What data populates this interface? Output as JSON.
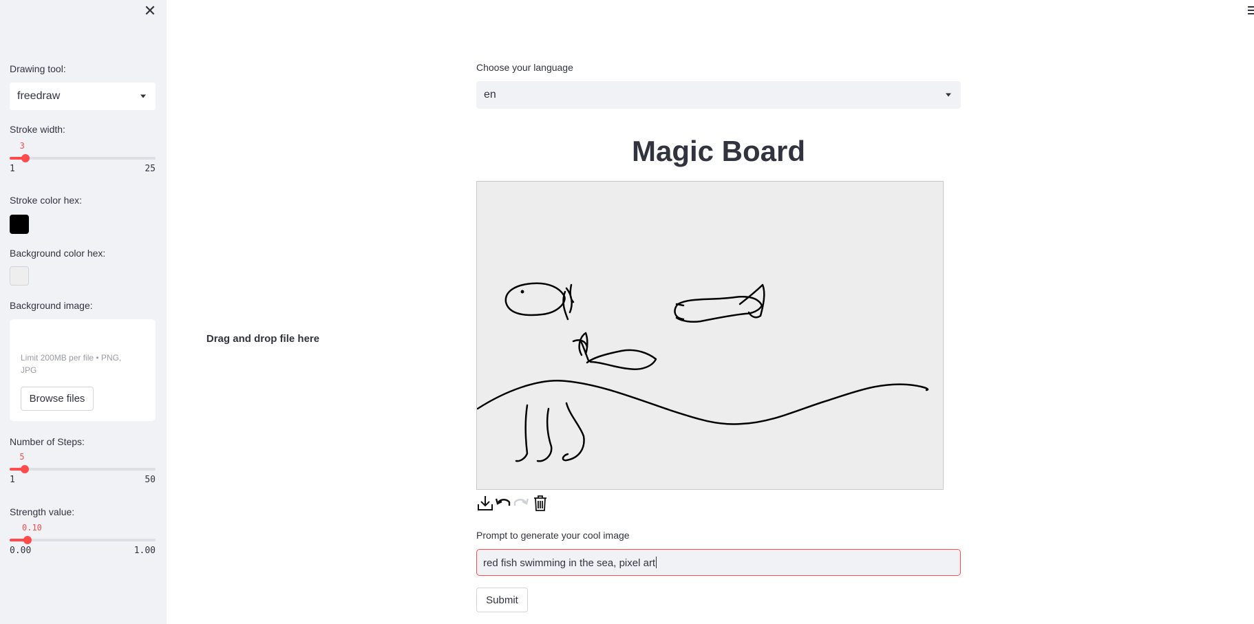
{
  "sidebar": {
    "drawing_tool": {
      "label": "Drawing tool:",
      "value": "freedraw"
    },
    "stroke_width": {
      "label": "Stroke width:",
      "value": "3",
      "min": "1",
      "max": "25",
      "fraction": 0.083
    },
    "stroke_color": {
      "label": "Stroke color hex:",
      "color": "#000000"
    },
    "background_color": {
      "label": "Background color hex:",
      "color": "#eeeeee"
    },
    "background_image": {
      "label": "Background image:",
      "dropzone_title": "Drag and drop file here",
      "limit_text": "Limit 200MB per file • PNG, JPG",
      "browse_label": "Browse files"
    },
    "steps": {
      "label": "Number of Steps:",
      "value": "5",
      "min": "1",
      "max": "50",
      "fraction": 0.082
    },
    "strength": {
      "label": "Strength value:",
      "value": "0.10",
      "min": "0.00",
      "max": "1.00",
      "fraction": 0.1
    }
  },
  "main": {
    "language": {
      "label": "Choose your language",
      "value": "en"
    },
    "title": "Magic Board",
    "canvas": {
      "background": "#ededed",
      "tools": [
        "download-icon",
        "undo-icon",
        "redo-icon",
        "trash-icon"
      ]
    },
    "prompt": {
      "label": "Prompt to generate your cool image",
      "value": "red fish swimming in the sea, pixel art"
    },
    "submit_label": "Submit"
  },
  "colors": {
    "accent": "#ff4b4b",
    "sidebar_bg": "#f0f2f6"
  }
}
